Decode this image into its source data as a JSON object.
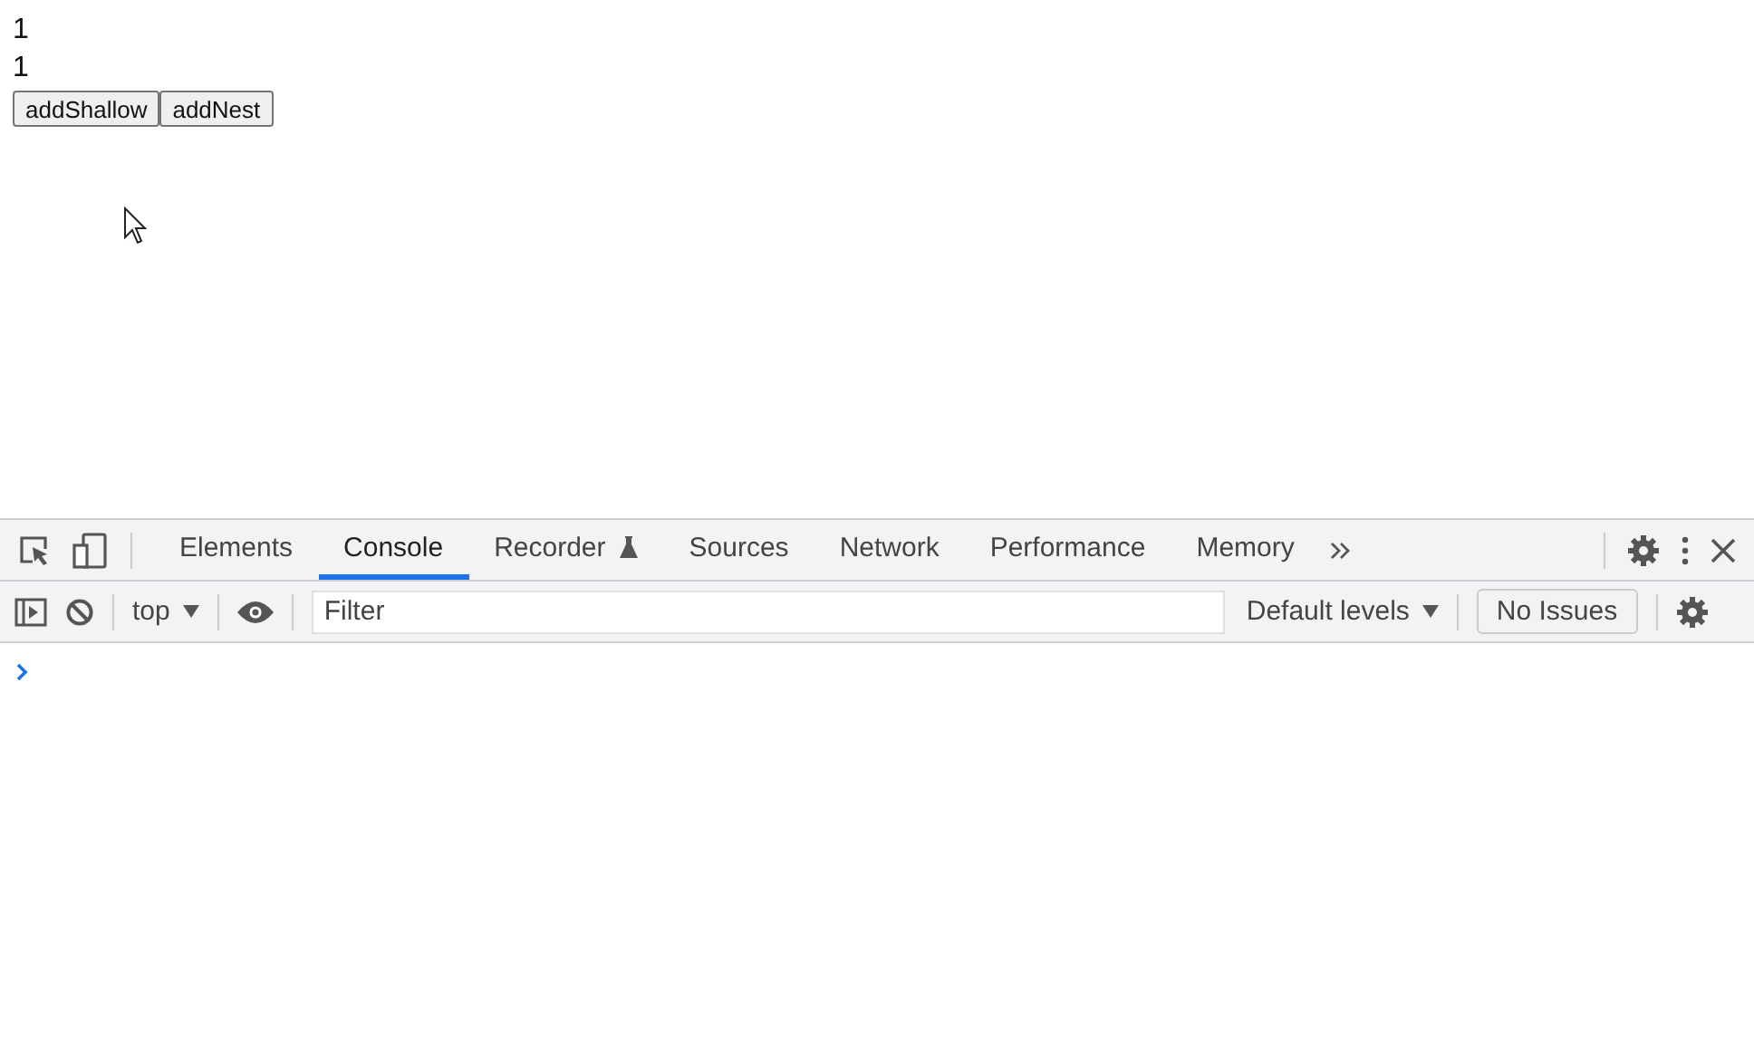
{
  "page": {
    "lines": [
      "1",
      "1"
    ],
    "buttons": [
      "addShallow",
      "addNest"
    ]
  },
  "devtools": {
    "tabs": [
      {
        "label": "Elements",
        "selected": false
      },
      {
        "label": "Console",
        "selected": true
      },
      {
        "label": "Recorder",
        "selected": false,
        "kind": "experimental"
      },
      {
        "label": "Sources",
        "selected": false
      },
      {
        "label": "Network",
        "selected": false
      },
      {
        "label": "Performance",
        "selected": false
      },
      {
        "label": "Memory",
        "selected": false
      }
    ],
    "console_toolbar": {
      "context": "top",
      "filter": {
        "placeholder": "Filter"
      },
      "levels": "Default levels",
      "issues": "No Issues"
    }
  }
}
